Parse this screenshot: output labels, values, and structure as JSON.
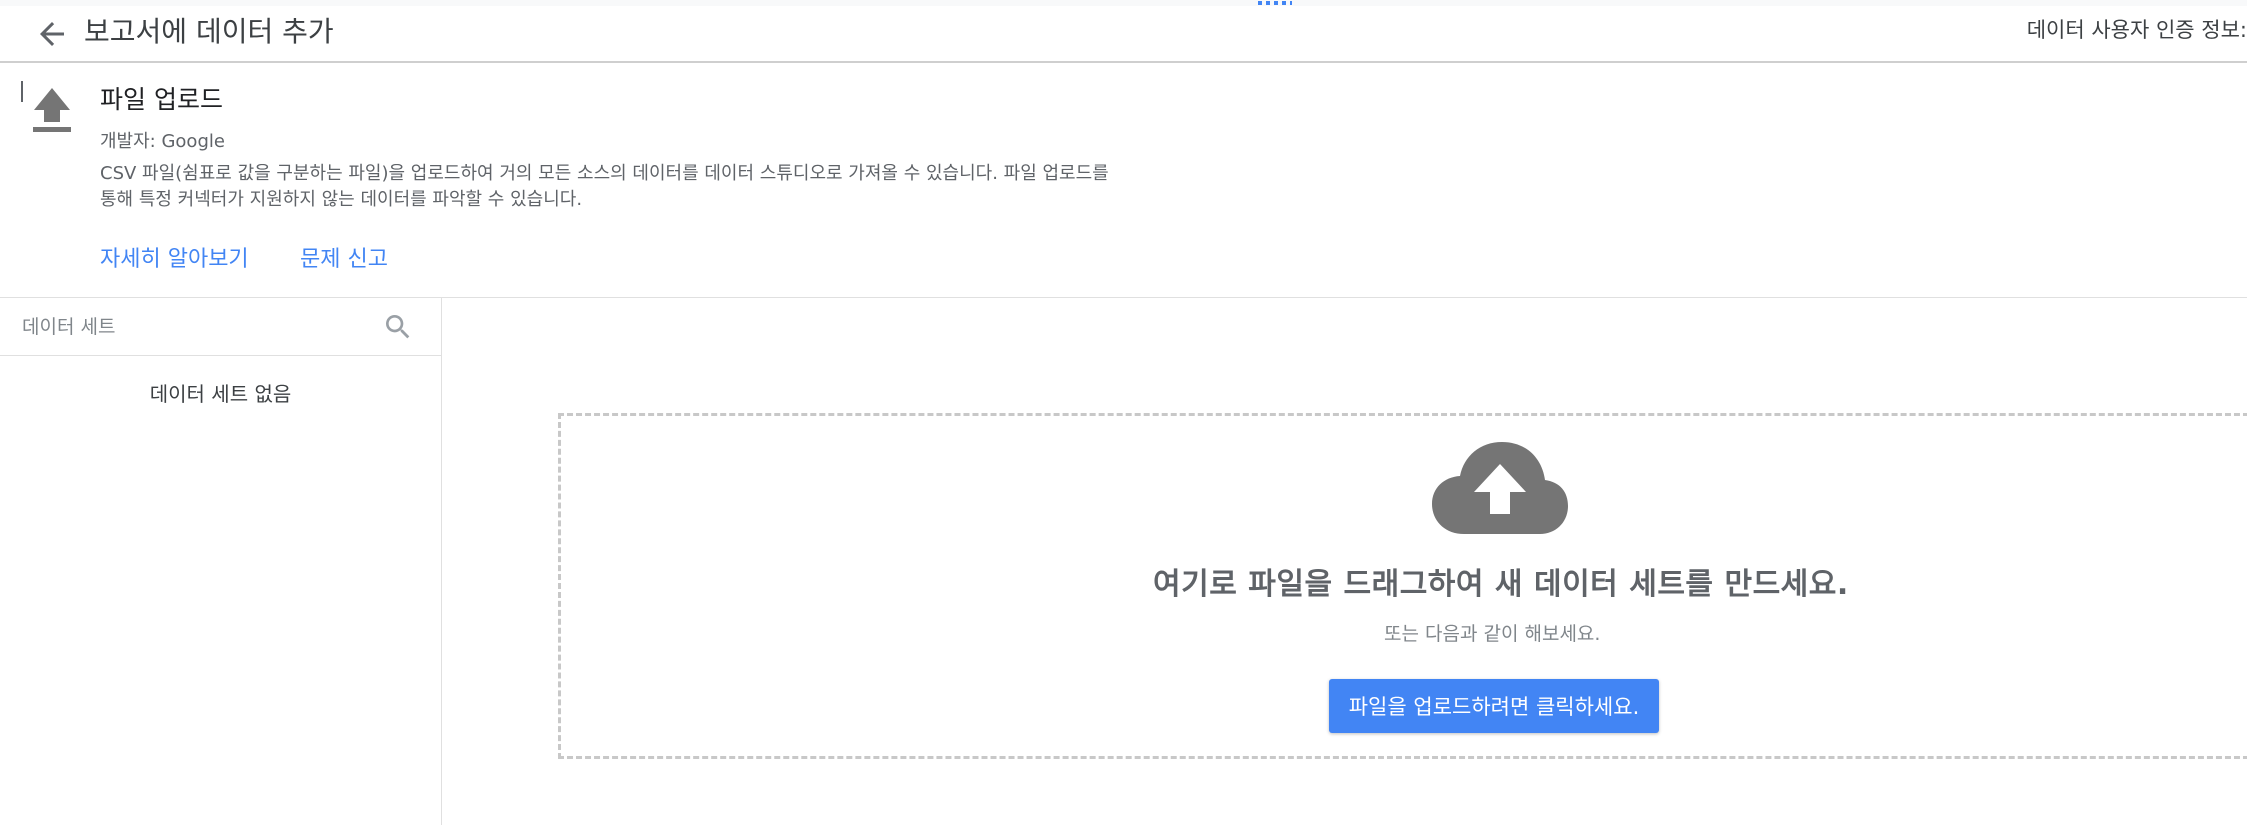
{
  "header": {
    "back_icon": "arrow-back-icon",
    "title": "보고서에 데이터 추가",
    "credentials_label": "데이터 사용자 인증 정보:"
  },
  "connector": {
    "icon": "upload-icon",
    "name": "파일 업로드",
    "developer": "개발자: Google",
    "description_line1": "CSV 파일(쉼표로 값을 구분하는 파일)을 업로드하여 거의 모든 소스의 데이터를 데이터 스튜디오로 가져올 수 있습니다. 파일 업로드를",
    "description_line2": "통해 특정 커넥터가 지원하지 않는 데이터를 파악할 수 있습니다.",
    "learn_more": "자세히 알아보기",
    "report_issue": "문제 신고"
  },
  "sidebar": {
    "search_placeholder": "데이터 세트",
    "search_icon": "search-icon",
    "empty_message": "데이터 세트 없음"
  },
  "dropzone": {
    "icon": "cloud-upload-icon",
    "title": "여기로 파일을 드래그하여 새 데이터 세트를 만드세요.",
    "subtitle": "또는 다음과 같이 해보세요.",
    "button_label": "파일을 업로드하려면 클릭하세요."
  },
  "colors": {
    "accent": "#4285f4",
    "icon_gray": "#757575",
    "text_secondary": "#5f6368"
  }
}
